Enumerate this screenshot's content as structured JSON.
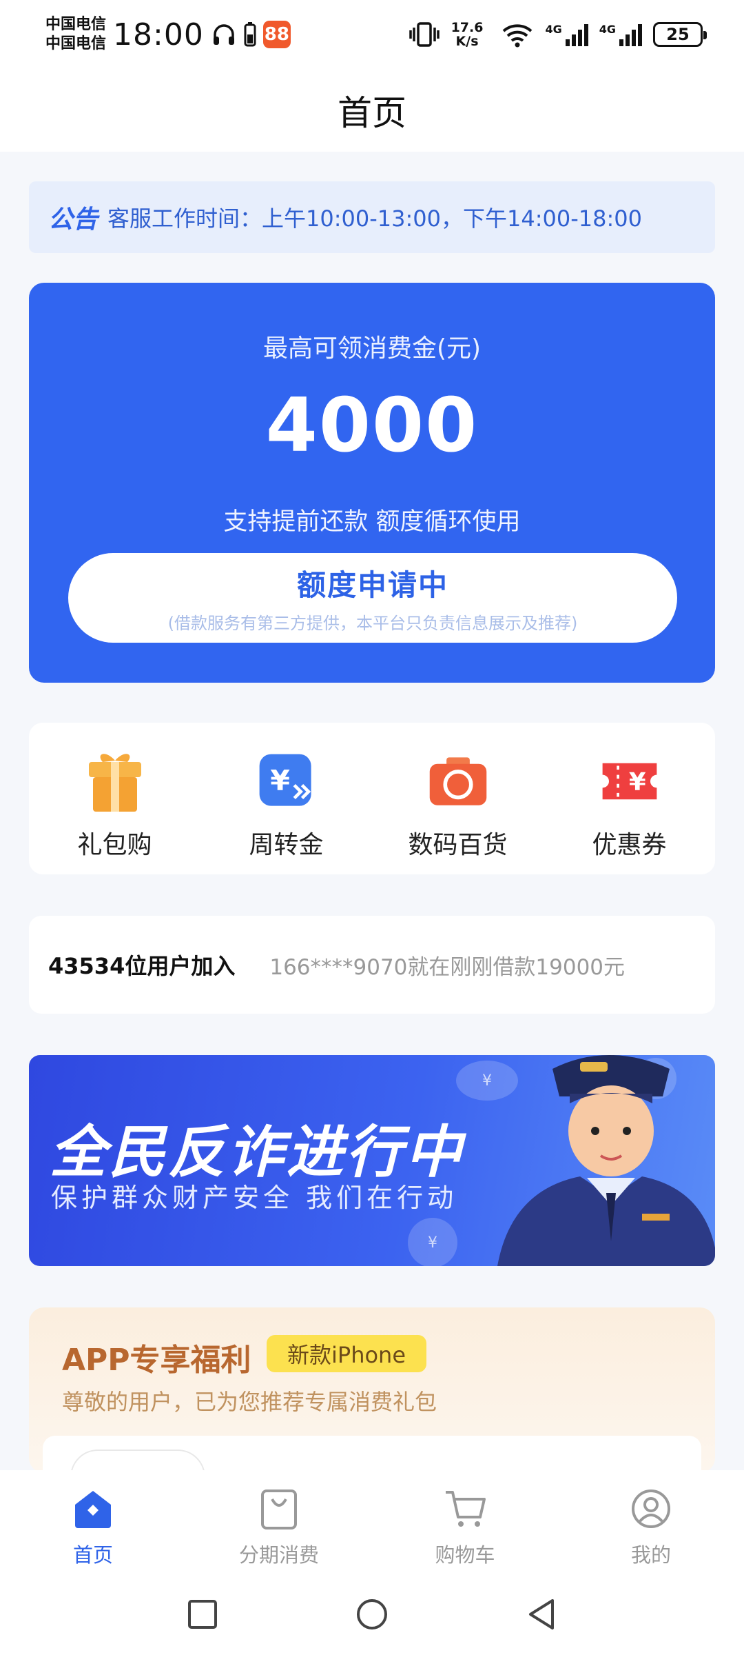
{
  "status_bar": {
    "carrier_1": "中国电信",
    "carrier_2": "中国电信",
    "time": "18:00",
    "app_badge": "88",
    "net_speed_value": "17.6",
    "net_speed_unit": "K/s",
    "sim_tag_1": "4G",
    "sim_tag_2": "4G",
    "battery": "25"
  },
  "header": {
    "title": "首页"
  },
  "notice": {
    "tag": "公告",
    "text": "客服工作时间：上午10:00-13:00，下午14:00-18:00"
  },
  "hero": {
    "label": "最高可领消费金(元)",
    "amount": "4000",
    "subtitle": "支持提前还款 额度循环使用",
    "button_label": "额度申请中",
    "button_note": "(借款服务有第三方提供，本平台只负责信息展示及推荐)",
    "accent_color": "#3165f0"
  },
  "quick_menu": {
    "items": [
      {
        "label": "礼包购",
        "icon": "gift-icon"
      },
      {
        "label": "周转金",
        "icon": "yuan-transfer-icon"
      },
      {
        "label": "数码百货",
        "icon": "camera-icon"
      },
      {
        "label": "优惠券",
        "icon": "coupon-icon"
      }
    ]
  },
  "ticker": {
    "count_text": "43534位用户加入",
    "message": "166****9070就在刚刚借款19000元"
  },
  "banner": {
    "title": "全民反诈进行中",
    "subtitle": "保护群众财产安全 我们在行动",
    "coin_symbol": "¥"
  },
  "benefit": {
    "title": "APP专享福利",
    "tag": "新款iPhone",
    "subtitle": "尊敬的用户，已为您推荐专属消费礼包"
  },
  "tab_bar": {
    "items": [
      {
        "label": "首页",
        "icon": "home-icon",
        "active": true
      },
      {
        "label": "分期消费",
        "icon": "shopping-bag-icon",
        "active": false
      },
      {
        "label": "购物车",
        "icon": "cart-icon",
        "active": false
      },
      {
        "label": "我的",
        "icon": "profile-icon",
        "active": false
      }
    ]
  }
}
